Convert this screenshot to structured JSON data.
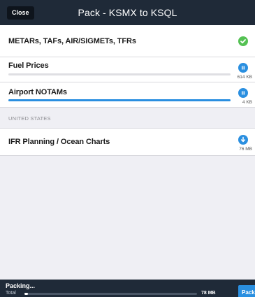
{
  "header": {
    "close_label": "Close",
    "title": "Pack - KSMX to KSQL"
  },
  "rows": [
    {
      "label": "METARs, TAFs, AIR/SIGMETs, TFRs",
      "status": "complete",
      "status_icon": "checkmark-icon",
      "status_color": "#54c153"
    },
    {
      "label": "Fuel Prices",
      "status": "paused",
      "status_icon": "pause-icon",
      "size": "614 KB",
      "progress": 0.0
    },
    {
      "label": "Airport NOTAMs",
      "status": "paused",
      "status_icon": "pause-icon",
      "size": "4 KB",
      "progress": 1.0
    }
  ],
  "section": {
    "header": "UNITED STATES",
    "items": [
      {
        "label": "IFR Planning / Ocean Charts",
        "status": "download",
        "status_icon": "download-icon",
        "size": "76 MB"
      }
    ]
  },
  "footer": {
    "packing_label": "Packing...",
    "total_label": "Total",
    "total_size": "78 MB",
    "total_progress": 0.02,
    "pack_label": "Pack"
  },
  "colors": {
    "header_bg": "#1f2a38",
    "accent": "#2a8fe0",
    "success": "#54c153"
  }
}
